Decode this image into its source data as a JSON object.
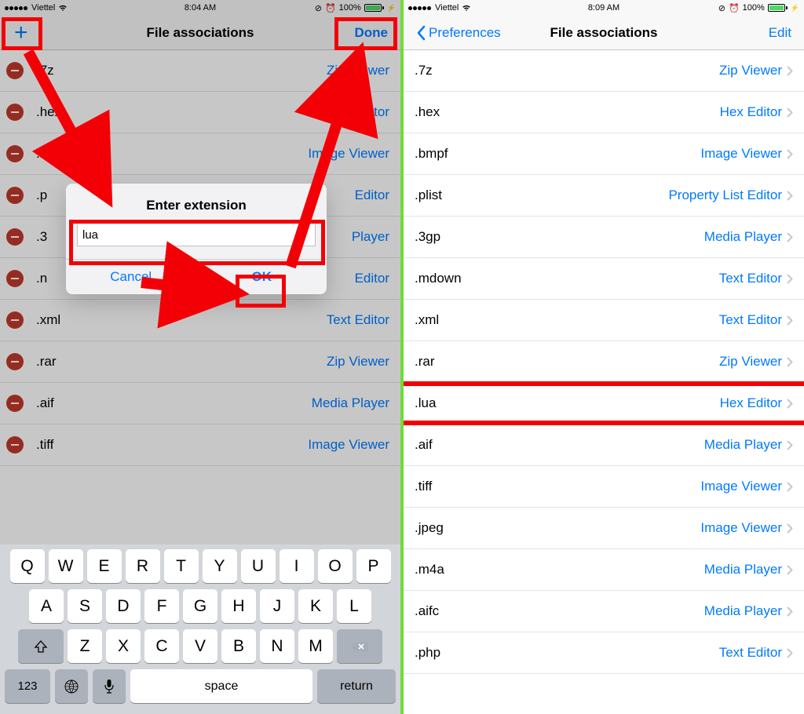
{
  "left": {
    "status": {
      "carrier": "Viettel",
      "time": "8:04 AM",
      "battery": "100%"
    },
    "nav": {
      "title": "File associations",
      "done": "Done",
      "add": "+"
    },
    "alert": {
      "title": "Enter extension",
      "value": "lua",
      "cancel": "Cancel",
      "ok": "OK"
    },
    "rows": [
      {
        "ext": ".7z",
        "assoc": "Zip Viewer"
      },
      {
        "ext": ".hex",
        "assoc": "Hex Editor"
      },
      {
        "ext": ".bmpf",
        "assoc": "Image Viewer"
      },
      {
        "ext": ".p",
        "assoc": "Editor"
      },
      {
        "ext": ".3",
        "assoc": "Player"
      },
      {
        "ext": ".n",
        "assoc": "Editor"
      },
      {
        "ext": ".xml",
        "assoc": "Text Editor"
      },
      {
        "ext": ".rar",
        "assoc": "Zip Viewer"
      },
      {
        "ext": ".aif",
        "assoc": "Media Player"
      },
      {
        "ext": ".tiff",
        "assoc": "Image Viewer"
      }
    ],
    "keyboard": {
      "row1": [
        "Q",
        "W",
        "E",
        "R",
        "T",
        "Y",
        "U",
        "I",
        "O",
        "P"
      ],
      "row2": [
        "A",
        "S",
        "D",
        "F",
        "G",
        "H",
        "J",
        "K",
        "L"
      ],
      "row3": [
        "Z",
        "X",
        "C",
        "V",
        "B",
        "N",
        "M"
      ],
      "num": "123",
      "space": "space",
      "ret": "return"
    }
  },
  "right": {
    "status": {
      "carrier": "Viettel",
      "time": "8:09 AM",
      "battery": "100%"
    },
    "nav": {
      "back": "Preferences",
      "title": "File associations",
      "edit": "Edit"
    },
    "rows": [
      {
        "ext": ".7z",
        "assoc": "Zip Viewer"
      },
      {
        "ext": ".hex",
        "assoc": "Hex Editor"
      },
      {
        "ext": ".bmpf",
        "assoc": "Image Viewer"
      },
      {
        "ext": ".plist",
        "assoc": "Property List Editor"
      },
      {
        "ext": ".3gp",
        "assoc": "Media Player"
      },
      {
        "ext": ".mdown",
        "assoc": "Text Editor"
      },
      {
        "ext": ".xml",
        "assoc": "Text Editor"
      },
      {
        "ext": ".rar",
        "assoc": "Zip Viewer"
      },
      {
        "ext": ".lua",
        "assoc": "Hex Editor",
        "hl": true
      },
      {
        "ext": ".aif",
        "assoc": "Media Player"
      },
      {
        "ext": ".tiff",
        "assoc": "Image Viewer"
      },
      {
        "ext": ".jpeg",
        "assoc": "Image Viewer"
      },
      {
        "ext": ".m4a",
        "assoc": "Media Player"
      },
      {
        "ext": ".aifc",
        "assoc": "Media Player"
      },
      {
        "ext": ".php",
        "assoc": "Text Editor"
      }
    ]
  }
}
